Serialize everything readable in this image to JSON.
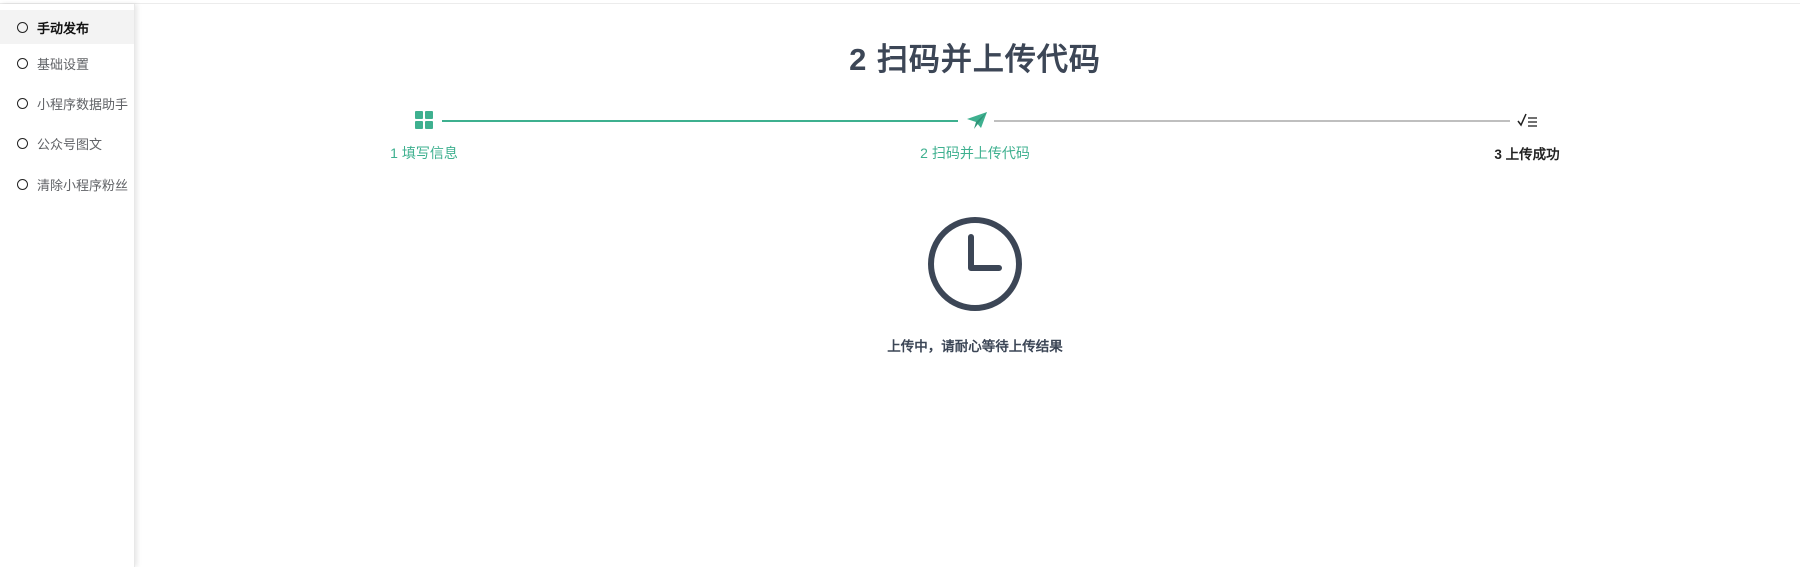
{
  "sidebar": {
    "items": [
      {
        "label": "手动发布",
        "active": true
      },
      {
        "label": "基础设置",
        "active": false
      },
      {
        "label": "小程序数据助手",
        "active": false
      },
      {
        "label": "公众号图文",
        "active": false
      },
      {
        "label": "清除小程序粉丝",
        "active": false
      }
    ]
  },
  "main": {
    "title": "2 扫码并上传代码",
    "steps": [
      {
        "label": "1 填写信息",
        "icon": "grid-icon",
        "state": "done"
      },
      {
        "label": "2 扫码并上传代码",
        "icon": "paper-plane-icon",
        "state": "current"
      },
      {
        "label": "3 上传成功",
        "icon": "checklist-icon",
        "state": "pending"
      }
    ],
    "status_icon": "clock-icon",
    "status_text": "上传中，请耐心等待上传结果"
  },
  "colors": {
    "accent": "#3eb08f",
    "title": "#3c4656",
    "pending_line": "#bfbfbf"
  }
}
